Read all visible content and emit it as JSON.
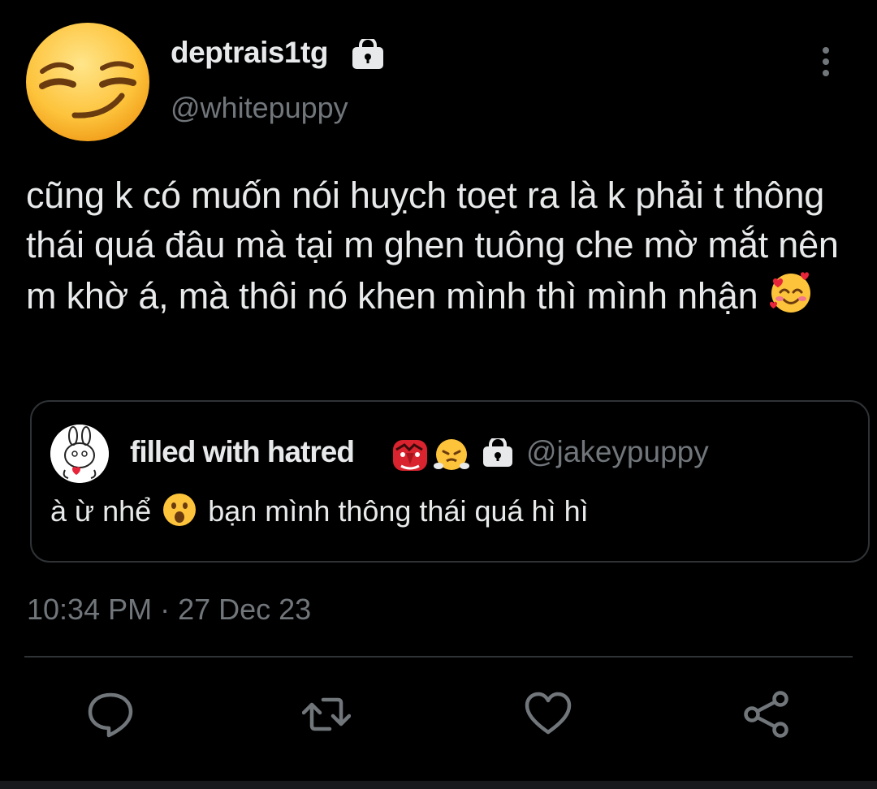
{
  "tweet": {
    "author": {
      "display_name": "deptrais1tg",
      "handle": "@whitepuppy",
      "avatar_icon": "smirking-face-emoji",
      "locked_icon": "lock-icon"
    },
    "text": "cũng k có muốn nói huỵch toẹt ra là k phải t thông thái quá đâu mà tại m ghen tuông che mờ mắt nên m khờ á, mà thôi nó khen mình thì mình nhận",
    "text_emoji": "smiling-face-with-hearts-emoji",
    "timestamp": "10:34 PM · 27 Dec 23"
  },
  "quoted_tweet": {
    "display_name": "filled with hatred",
    "name_emojis": [
      "goblin-emoji",
      "face-with-steam-emoji"
    ],
    "locked_icon": "lock-icon",
    "handle": "@jakeypuppy",
    "text_before": "à ừ nhể",
    "text_emoji": "face-with-open-mouth-emoji",
    "text_after": "bạn mình thông thái quá hì hì",
    "avatar_icon": "bunny-doodle-avatar"
  },
  "actions": [
    {
      "name": "reply",
      "icon": "reply-bubble-icon"
    },
    {
      "name": "retweet",
      "icon": "retweet-icon"
    },
    {
      "name": "like",
      "icon": "heart-icon"
    },
    {
      "name": "share",
      "icon": "share-icon"
    }
  ],
  "colors": {
    "background": "#000000",
    "primary_text": "#e7e9ea",
    "secondary_text": "#71767b",
    "border": "#2f3336"
  }
}
